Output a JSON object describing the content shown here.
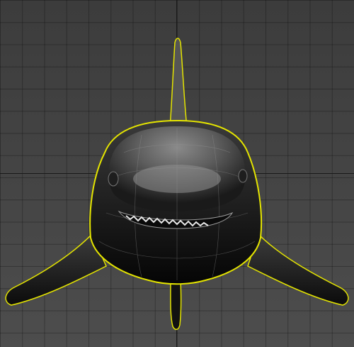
{
  "viewport": {
    "label": "",
    "selection_color": "#e4e400",
    "grid": true
  },
  "model": {
    "icon": "shark-model-icon",
    "selected": true
  }
}
